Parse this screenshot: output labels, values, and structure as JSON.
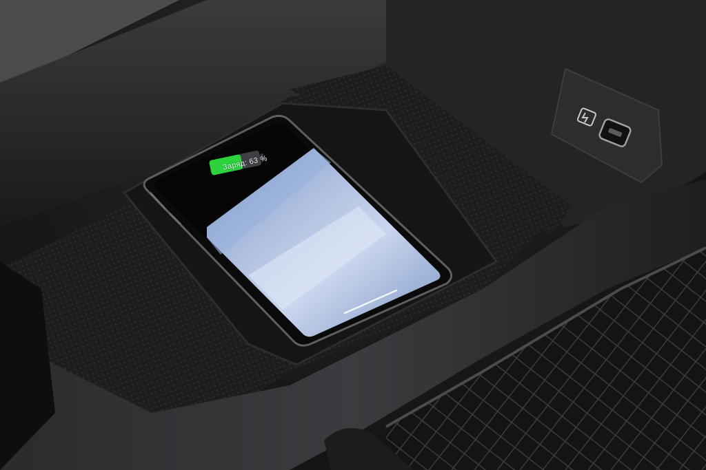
{
  "phone": {
    "charge_label": "Заряд: 63 %",
    "charge_level": 0.63,
    "battery_fill_color": "#2bd43c"
  },
  "console": {
    "usb_port_icon": "usb-c-port-icon",
    "charging_symbol_icon": "battery-charging-icon"
  }
}
